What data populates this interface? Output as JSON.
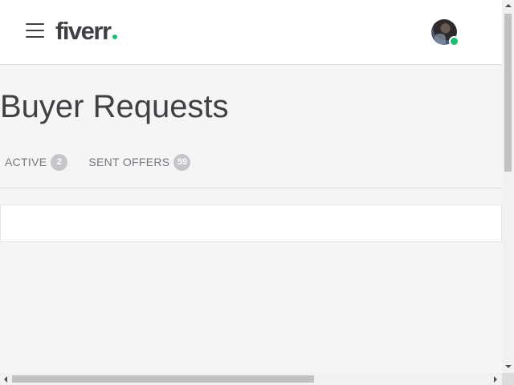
{
  "header": {
    "logo_text": "fiverr",
    "logo_dot_color": "#1dbf73",
    "menu_icon": "hamburger-menu-icon",
    "avatar_status": "online",
    "avatar_status_color": "#1dbf73"
  },
  "page": {
    "title": "Buyer Requests"
  },
  "tabs": [
    {
      "label": "ACTIVE",
      "count": "2"
    },
    {
      "label": "SENT OFFERS",
      "count": "59"
    }
  ],
  "colors": {
    "text_primary": "#404145",
    "text_muted": "#74767e",
    "badge_bg": "#c5c6c9",
    "page_bg": "#f5f5f5",
    "brand_green": "#1dbf73"
  }
}
